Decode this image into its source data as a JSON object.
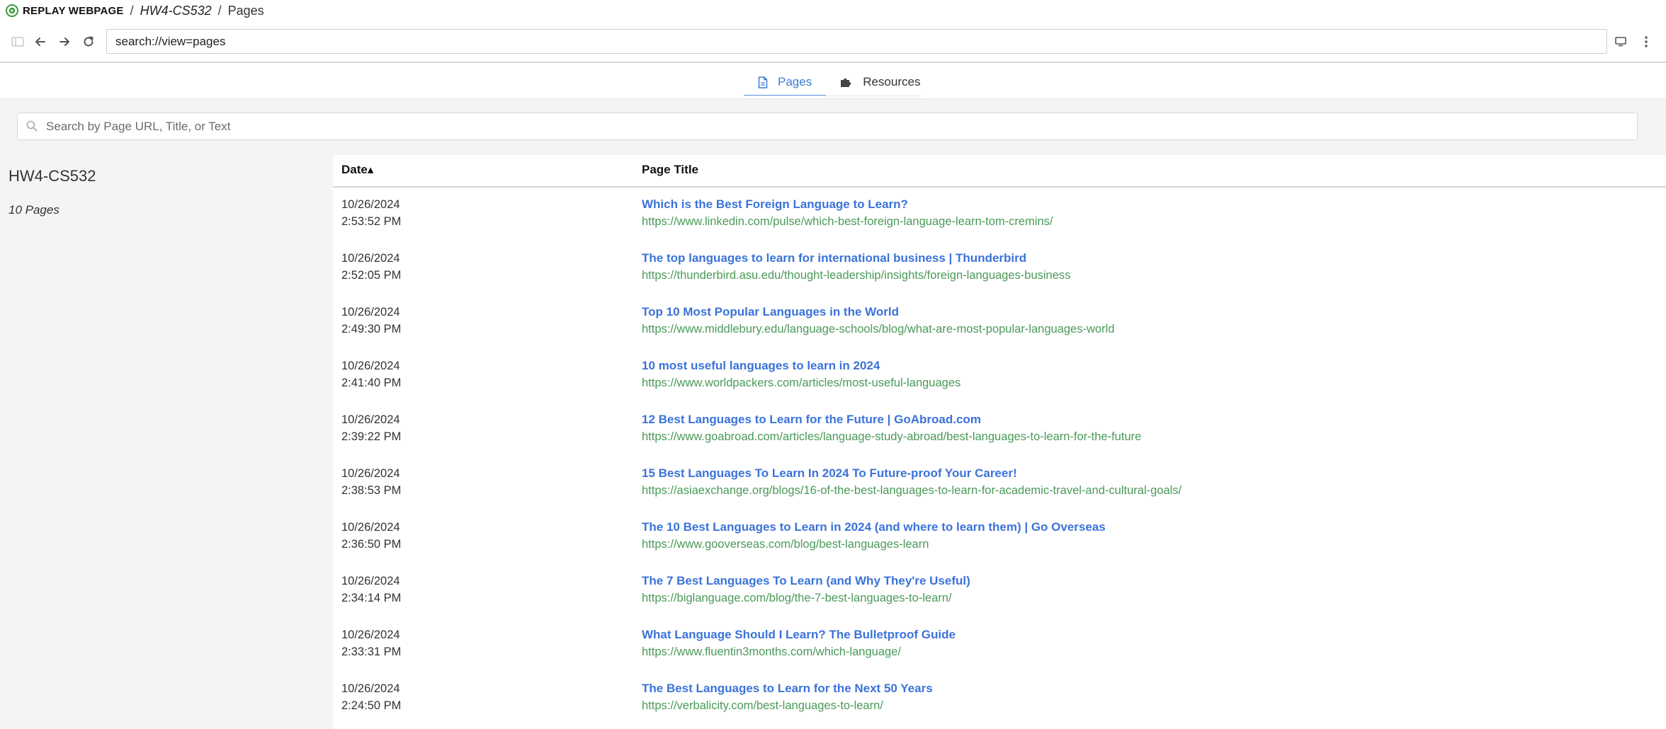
{
  "topbar": {
    "brand": "REPLAY WEBPAGE",
    "separator": "/",
    "collection": "HW4-CS532",
    "page": "Pages"
  },
  "address": {
    "value": "search://view=pages"
  },
  "tabs": [
    {
      "label": "Pages",
      "icon": "page-icon",
      "active": true
    },
    {
      "label": "Resources",
      "icon": "puzzle-icon",
      "active": false
    }
  ],
  "search": {
    "placeholder": "Search by Page URL, Title, or Text"
  },
  "sidebar": {
    "title": "HW4-CS532",
    "count": "10 Pages"
  },
  "table": {
    "col_date": "Date▴",
    "col_title": "Page Title",
    "rows": [
      {
        "date": "10/26/2024",
        "time": "2:53:52 PM",
        "title": "Which is the Best Foreign Language to Learn?",
        "url": "https://www.linkedin.com/pulse/which-best-foreign-language-learn-tom-cremins/"
      },
      {
        "date": "10/26/2024",
        "time": "2:52:05 PM",
        "title": "The top languages to learn for international business | Thunderbird",
        "url": "https://thunderbird.asu.edu/thought-leadership/insights/foreign-languages-business"
      },
      {
        "date": "10/26/2024",
        "time": "2:49:30 PM",
        "title": "Top 10 Most Popular Languages in the World",
        "url": "https://www.middlebury.edu/language-schools/blog/what-are-most-popular-languages-world"
      },
      {
        "date": "10/26/2024",
        "time": "2:41:40 PM",
        "title": "10 most useful languages to learn in 2024",
        "url": "https://www.worldpackers.com/articles/most-useful-languages"
      },
      {
        "date": "10/26/2024",
        "time": "2:39:22 PM",
        "title": "12 Best Languages to Learn for the Future | GoAbroad.com",
        "url": "https://www.goabroad.com/articles/language-study-abroad/best-languages-to-learn-for-the-future"
      },
      {
        "date": "10/26/2024",
        "time": "2:38:53 PM",
        "title": "15 Best Languages To Learn In 2024 To Future-proof Your Career!",
        "url": "https://asiaexchange.org/blogs/16-of-the-best-languages-to-learn-for-academic-travel-and-cultural-goals/"
      },
      {
        "date": "10/26/2024",
        "time": "2:36:50 PM",
        "title": "The 10 Best Languages to Learn in 2024 (and where to learn them) | Go Overseas",
        "url": "https://www.gooverseas.com/blog/best-languages-learn"
      },
      {
        "date": "10/26/2024",
        "time": "2:34:14 PM",
        "title": "The 7 Best Languages To Learn (and Why They're Useful)",
        "url": "https://biglanguage.com/blog/the-7-best-languages-to-learn/"
      },
      {
        "date": "10/26/2024",
        "time": "2:33:31 PM",
        "title": "What Language Should I Learn? The Bulletproof Guide",
        "url": "https://www.fluentin3months.com/which-language/"
      },
      {
        "date": "10/26/2024",
        "time": "2:24:50 PM",
        "title": "The Best Languages to Learn for the Next 50 Years",
        "url": "https://verbalicity.com/best-languages-to-learn/"
      }
    ]
  },
  "colors": {
    "link": "#3a73d9",
    "url": "#4a9a58",
    "accent": "#3a7bd5",
    "panel": "#f4f4f4",
    "logo": "#3d9a3f"
  }
}
